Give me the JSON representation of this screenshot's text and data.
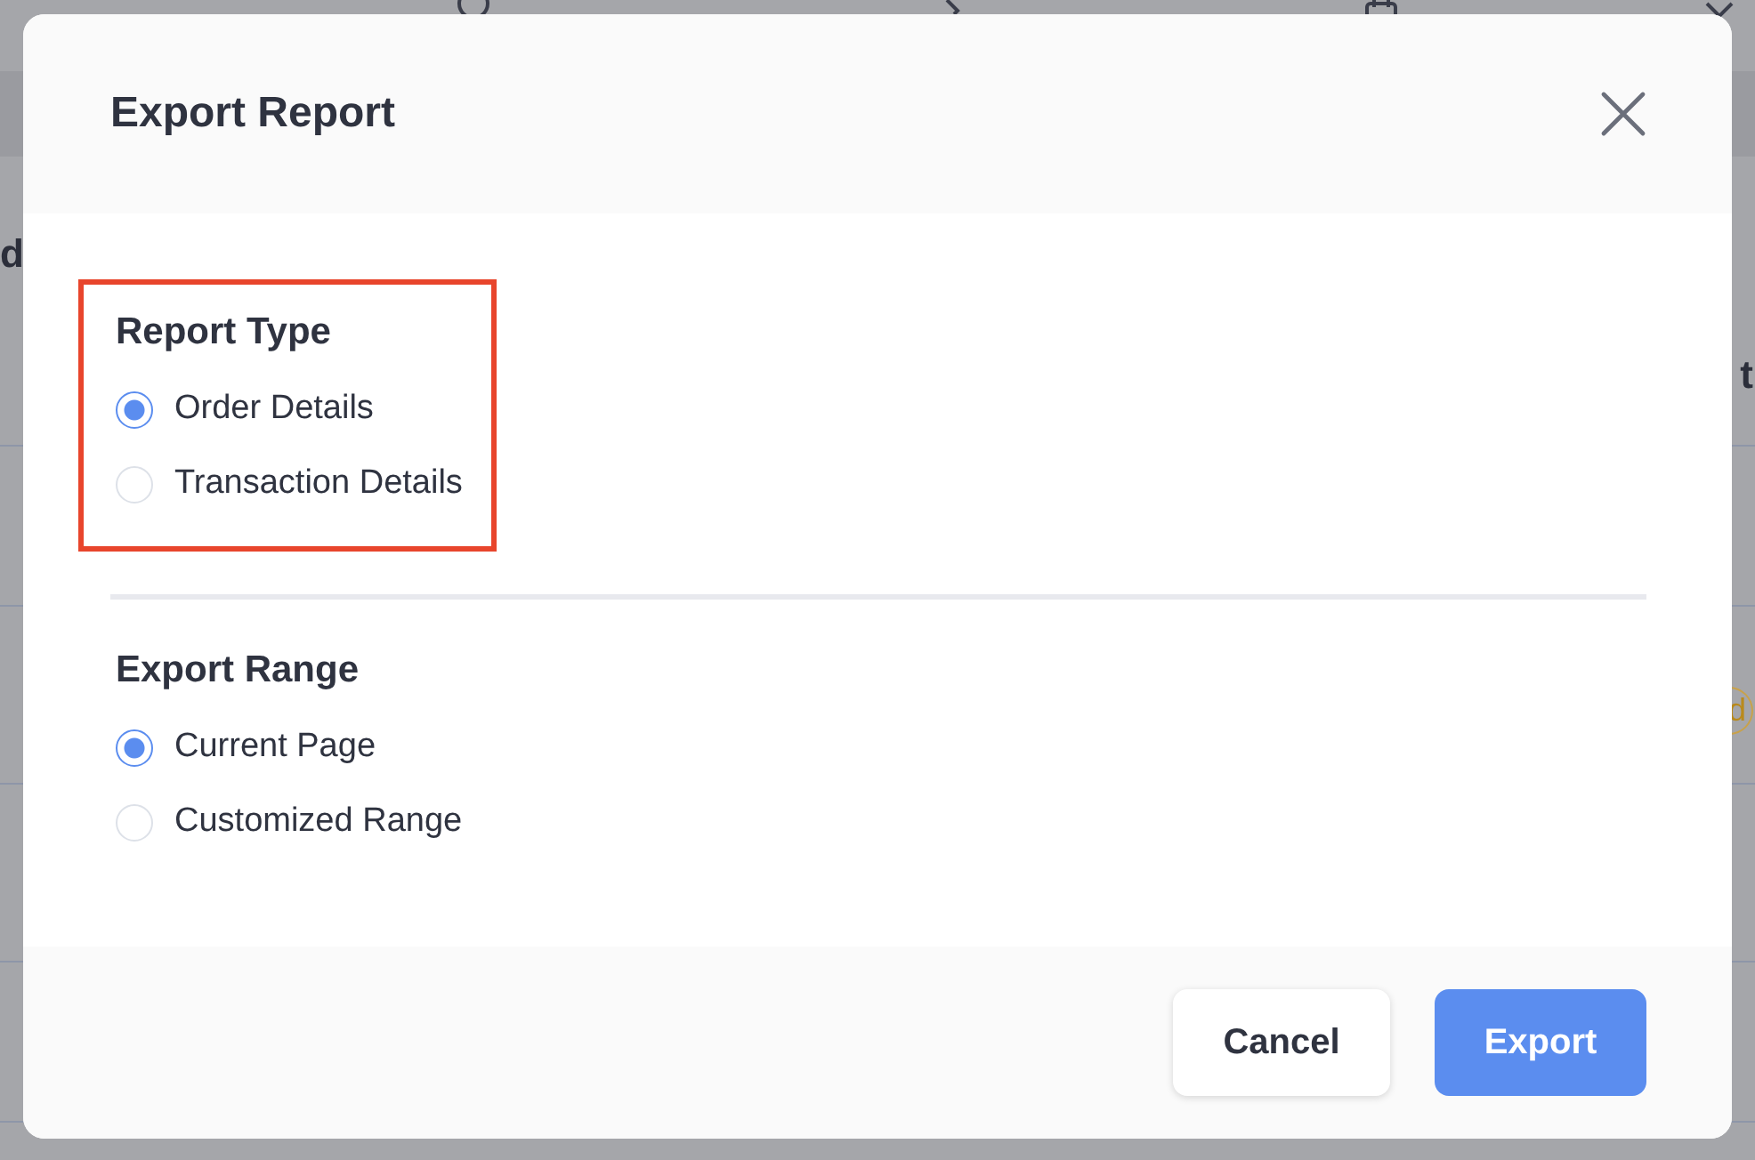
{
  "background": {
    "fragments": [
      {
        "kind": "row_label",
        "text": "d"
      },
      {
        "kind": "heading",
        "text": "t"
      },
      {
        "kind": "badge",
        "text": "d"
      }
    ]
  },
  "dialog": {
    "title": "Export Report",
    "sections": [
      {
        "heading": "Report Type",
        "highlighted": true,
        "options": [
          {
            "label": "Order Details",
            "selected": true
          },
          {
            "label": "Transaction Details",
            "selected": false
          }
        ]
      },
      {
        "heading": "Export Range",
        "highlighted": false,
        "options": [
          {
            "label": "Current Page",
            "selected": true
          },
          {
            "label": "Customized Range",
            "selected": false
          }
        ]
      }
    ],
    "buttons": [
      {
        "label": "Cancel",
        "kind": "secondary"
      },
      {
        "label": "Export",
        "kind": "primary"
      }
    ]
  }
}
